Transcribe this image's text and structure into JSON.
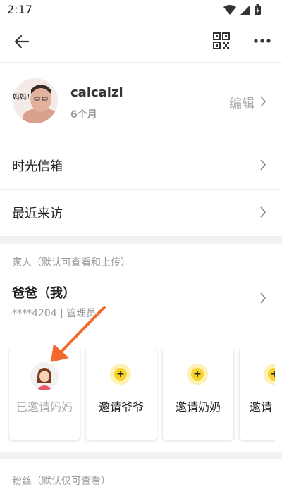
{
  "status": {
    "time": "2:17"
  },
  "profile": {
    "name": "caicaizi",
    "age": "6个月",
    "edit": "编辑",
    "badge": "妈妈！"
  },
  "menu": [
    {
      "label": "时光信箱"
    },
    {
      "label": "最近来访"
    }
  ],
  "family": {
    "title": "家人（默认可查看和上传）",
    "member_name": "爸爸（我）",
    "member_info": "****4204 | 管理员",
    "invites": [
      {
        "label": "已邀请妈妈",
        "invited": true
      },
      {
        "label": "邀请爷爷",
        "invited": false
      },
      {
        "label": "邀请奶奶",
        "invited": false
      },
      {
        "label": "邀请",
        "invited": false
      }
    ]
  },
  "fans": {
    "title": "粉丝（默认仅可查看）"
  },
  "colors": {
    "accent": "#f8d129",
    "arrow": "#f26a2b"
  }
}
